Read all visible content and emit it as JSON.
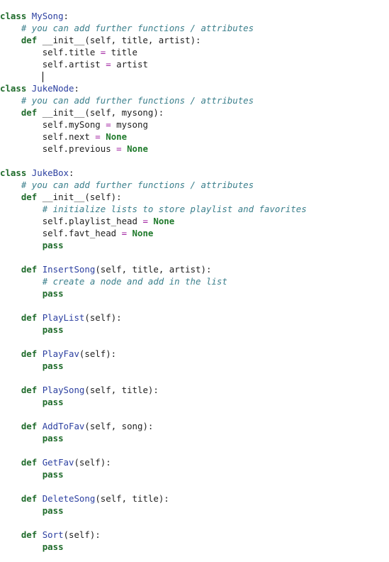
{
  "editor": {
    "language": "python",
    "colors": {
      "keyword": "#1f6b2b",
      "name": "#2b3fa0",
      "comment": "#3b7f8c",
      "operator": "#a020a0",
      "constant": "#1f7a2b"
    },
    "lines": [
      {
        "indent": "",
        "tokens": [
          {
            "t": "kw",
            "v": "class"
          },
          {
            "t": "",
            "v": " "
          },
          {
            "t": "cls",
            "v": "MySong"
          },
          {
            "t": "",
            "v": ":"
          }
        ]
      },
      {
        "indent": "    ",
        "tokens": [
          {
            "t": "cm",
            "v": "# you can add further functions / attributes"
          }
        ]
      },
      {
        "indent": "    ",
        "tokens": [
          {
            "t": "kw",
            "v": "def"
          },
          {
            "t": "",
            "v": " __init__(self, title, artist):"
          }
        ]
      },
      {
        "indent": "        ",
        "tokens": [
          {
            "t": "",
            "v": "self.title "
          },
          {
            "t": "op",
            "v": "="
          },
          {
            "t": "",
            "v": " title"
          }
        ]
      },
      {
        "indent": "        ",
        "tokens": [
          {
            "t": "",
            "v": "self.artist "
          },
          {
            "t": "op",
            "v": "="
          },
          {
            "t": "",
            "v": " artist"
          }
        ]
      },
      {
        "indent": "        ",
        "tokens": [],
        "cursor": true
      },
      {
        "indent": "",
        "tokens": [
          {
            "t": "kw",
            "v": "class"
          },
          {
            "t": "",
            "v": " "
          },
          {
            "t": "cls",
            "v": "JukeNode"
          },
          {
            "t": "",
            "v": ":"
          }
        ]
      },
      {
        "indent": "    ",
        "tokens": [
          {
            "t": "cm",
            "v": "# you can add further functions / attributes"
          }
        ]
      },
      {
        "indent": "    ",
        "tokens": [
          {
            "t": "kw",
            "v": "def"
          },
          {
            "t": "",
            "v": " __init__(self, mysong):"
          }
        ]
      },
      {
        "indent": "        ",
        "tokens": [
          {
            "t": "",
            "v": "self.mySong "
          },
          {
            "t": "op",
            "v": "="
          },
          {
            "t": "",
            "v": " mysong"
          }
        ]
      },
      {
        "indent": "        ",
        "tokens": [
          {
            "t": "",
            "v": "self.next "
          },
          {
            "t": "op",
            "v": "="
          },
          {
            "t": "",
            "v": " "
          },
          {
            "t": "const",
            "v": "None"
          }
        ]
      },
      {
        "indent": "        ",
        "tokens": [
          {
            "t": "",
            "v": "self.previous "
          },
          {
            "t": "op",
            "v": "="
          },
          {
            "t": "",
            "v": " "
          },
          {
            "t": "const",
            "v": "None"
          }
        ]
      },
      {
        "indent": "",
        "tokens": []
      },
      {
        "indent": "",
        "tokens": [
          {
            "t": "kw",
            "v": "class"
          },
          {
            "t": "",
            "v": " "
          },
          {
            "t": "cls",
            "v": "JukeBox"
          },
          {
            "t": "",
            "v": ":"
          }
        ]
      },
      {
        "indent": "    ",
        "tokens": [
          {
            "t": "cm",
            "v": "# you can add further functions / attributes"
          }
        ]
      },
      {
        "indent": "    ",
        "tokens": [
          {
            "t": "kw",
            "v": "def"
          },
          {
            "t": "",
            "v": " __init__(self):"
          }
        ]
      },
      {
        "indent": "        ",
        "tokens": [
          {
            "t": "cm",
            "v": "# initialize lists to store playlist and favorites"
          }
        ]
      },
      {
        "indent": "        ",
        "tokens": [
          {
            "t": "",
            "v": "self.playlist_head "
          },
          {
            "t": "op",
            "v": "="
          },
          {
            "t": "",
            "v": " "
          },
          {
            "t": "const",
            "v": "None"
          }
        ]
      },
      {
        "indent": "        ",
        "tokens": [
          {
            "t": "",
            "v": "self.favt_head "
          },
          {
            "t": "op",
            "v": "="
          },
          {
            "t": "",
            "v": " "
          },
          {
            "t": "const",
            "v": "None"
          }
        ]
      },
      {
        "indent": "        ",
        "tokens": [
          {
            "t": "kw",
            "v": "pass"
          }
        ]
      },
      {
        "indent": "",
        "tokens": []
      },
      {
        "indent": "    ",
        "tokens": [
          {
            "t": "kw",
            "v": "def"
          },
          {
            "t": "",
            "v": " "
          },
          {
            "t": "fn",
            "v": "InsertSong"
          },
          {
            "t": "",
            "v": "(self, title, artist):"
          }
        ]
      },
      {
        "indent": "        ",
        "tokens": [
          {
            "t": "cm",
            "v": "# create a node and add in the list"
          }
        ]
      },
      {
        "indent": "        ",
        "tokens": [
          {
            "t": "kw",
            "v": "pass"
          }
        ]
      },
      {
        "indent": "",
        "tokens": []
      },
      {
        "indent": "    ",
        "tokens": [
          {
            "t": "kw",
            "v": "def"
          },
          {
            "t": "",
            "v": " "
          },
          {
            "t": "fn",
            "v": "PlayList"
          },
          {
            "t": "",
            "v": "(self):"
          }
        ]
      },
      {
        "indent": "        ",
        "tokens": [
          {
            "t": "kw",
            "v": "pass"
          }
        ]
      },
      {
        "indent": "",
        "tokens": []
      },
      {
        "indent": "    ",
        "tokens": [
          {
            "t": "kw",
            "v": "def"
          },
          {
            "t": "",
            "v": " "
          },
          {
            "t": "fn",
            "v": "PlayFav"
          },
          {
            "t": "",
            "v": "(self):"
          }
        ]
      },
      {
        "indent": "        ",
        "tokens": [
          {
            "t": "kw",
            "v": "pass"
          }
        ]
      },
      {
        "indent": "",
        "tokens": []
      },
      {
        "indent": "    ",
        "tokens": [
          {
            "t": "kw",
            "v": "def"
          },
          {
            "t": "",
            "v": " "
          },
          {
            "t": "fn",
            "v": "PlaySong"
          },
          {
            "t": "",
            "v": "(self, title):"
          }
        ]
      },
      {
        "indent": "        ",
        "tokens": [
          {
            "t": "kw",
            "v": "pass"
          }
        ]
      },
      {
        "indent": "",
        "tokens": []
      },
      {
        "indent": "    ",
        "tokens": [
          {
            "t": "kw",
            "v": "def"
          },
          {
            "t": "",
            "v": " "
          },
          {
            "t": "fn",
            "v": "AddToFav"
          },
          {
            "t": "",
            "v": "(self, song):"
          }
        ]
      },
      {
        "indent": "        ",
        "tokens": [
          {
            "t": "kw",
            "v": "pass"
          }
        ]
      },
      {
        "indent": "",
        "tokens": []
      },
      {
        "indent": "    ",
        "tokens": [
          {
            "t": "kw",
            "v": "def"
          },
          {
            "t": "",
            "v": " "
          },
          {
            "t": "fn",
            "v": "GetFav"
          },
          {
            "t": "",
            "v": "(self):"
          }
        ]
      },
      {
        "indent": "        ",
        "tokens": [
          {
            "t": "kw",
            "v": "pass"
          }
        ]
      },
      {
        "indent": "",
        "tokens": []
      },
      {
        "indent": "    ",
        "tokens": [
          {
            "t": "kw",
            "v": "def"
          },
          {
            "t": "",
            "v": " "
          },
          {
            "t": "fn",
            "v": "DeleteSong"
          },
          {
            "t": "",
            "v": "(self, title):"
          }
        ]
      },
      {
        "indent": "        ",
        "tokens": [
          {
            "t": "kw",
            "v": "pass"
          }
        ]
      },
      {
        "indent": "",
        "tokens": []
      },
      {
        "indent": "    ",
        "tokens": [
          {
            "t": "kw",
            "v": "def"
          },
          {
            "t": "",
            "v": " "
          },
          {
            "t": "fn",
            "v": "Sort"
          },
          {
            "t": "",
            "v": "(self):"
          }
        ]
      },
      {
        "indent": "        ",
        "tokens": [
          {
            "t": "kw",
            "v": "pass"
          }
        ]
      }
    ]
  }
}
